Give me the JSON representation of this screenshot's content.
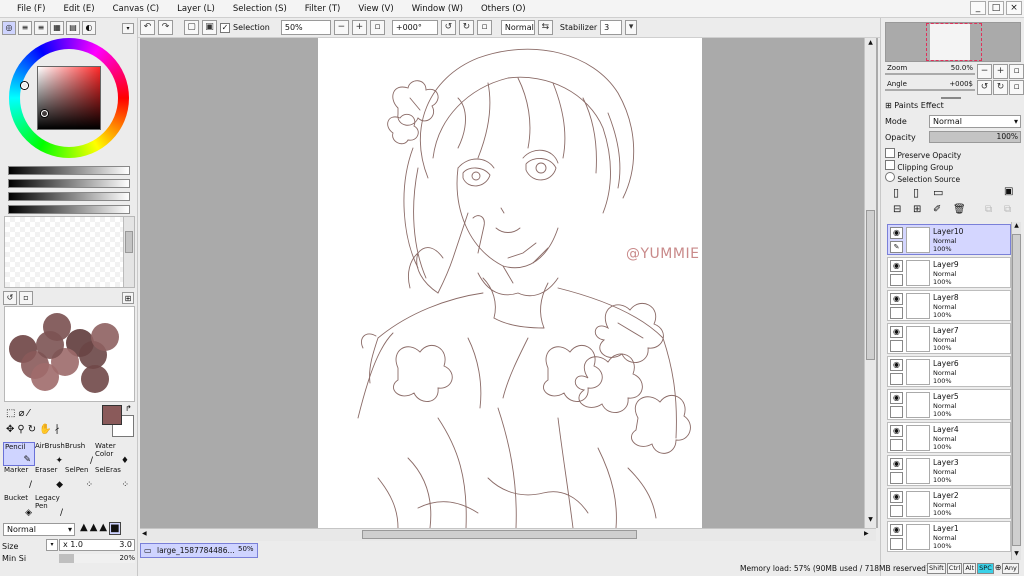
{
  "menu": [
    "File (F)",
    "Edit (E)",
    "Canvas (C)",
    "Layer (L)",
    "Selection (S)",
    "Filter (T)",
    "View (V)",
    "Window (W)",
    "Others (O)"
  ],
  "window_controls": [
    "_",
    "□",
    "×"
  ],
  "toolbar": {
    "selection_label": "Selection",
    "zoom_value": "50%",
    "angle_value": "+000°",
    "blend_value": "Normal",
    "stabilizer_label": "Stabilizer",
    "stabilizer_value": "3"
  },
  "left": {
    "tools": [
      {
        "label": "Pencil",
        "icon": "✎",
        "active": true
      },
      {
        "label": "AirBrush",
        "icon": "✦"
      },
      {
        "label": "Brush",
        "icon": "∕"
      },
      {
        "label": "Water Color",
        "icon": "♦"
      },
      {
        "label": "Marker",
        "icon": "∕"
      },
      {
        "label": "Eraser",
        "icon": "◆"
      },
      {
        "label": "SelPen",
        "icon": "⁘"
      },
      {
        "label": "SelEras",
        "icon": "⁘"
      },
      {
        "label": "Bucket",
        "icon": "◈"
      },
      {
        "label": "Legacy Pen",
        "icon": "∕"
      }
    ],
    "brush_mode": "Normal",
    "size_label": "Size",
    "size_multiplier": "x 1.0",
    "size_value": "3.0",
    "min_size_label": "Min Si",
    "min_size_value": "20%",
    "fg_color": "#8a5a5a",
    "palette_colors": [
      "#6e4444",
      "#7a5050",
      "#8a5a5a",
      "#5f3b3b",
      "#9c6a6a",
      "#6a4646",
      "#7c5353",
      "#8e6060",
      "#a06c6c",
      "#704848"
    ]
  },
  "canvas": {
    "watermark": "@YUMMIE",
    "watermark_color": "#c98a8a",
    "doc_tab_name": "large_1587784486...",
    "doc_tab_zoom": "50%"
  },
  "right": {
    "zoom_label": "Zoom",
    "zoom_value": "50.0%",
    "angle_label": "Angle",
    "angle_value": "+000$",
    "paints_effect": "Paints Effect",
    "mode_label": "Mode",
    "mode_value": "Normal",
    "opacity_label": "Opacity",
    "opacity_value": "100%",
    "preserve_opacity": "Preserve Opacity",
    "clipping_group": "Clipping Group",
    "selection_source": "Selection Source",
    "layers": [
      {
        "name": "Layer10",
        "mode": "Normal",
        "opacity": "100%",
        "active": true
      },
      {
        "name": "Layer9",
        "mode": "Normal",
        "opacity": "100%"
      },
      {
        "name": "Layer8",
        "mode": "Normal",
        "opacity": "100%"
      },
      {
        "name": "Layer7",
        "mode": "Normal",
        "opacity": "100%"
      },
      {
        "name": "Layer6",
        "mode": "Normal",
        "opacity": "100%"
      },
      {
        "name": "Layer5",
        "mode": "Normal",
        "opacity": "100%"
      },
      {
        "name": "Layer4",
        "mode": "Normal",
        "opacity": "100%"
      },
      {
        "name": "Layer3",
        "mode": "Normal",
        "opacity": "100%"
      },
      {
        "name": "Layer2",
        "mode": "Normal",
        "opacity": "100%"
      },
      {
        "name": "Layer1",
        "mode": "Normal",
        "opacity": "100%"
      }
    ]
  },
  "status": {
    "memory": "Memory load: 57% (90MB used / 718MB reserved)",
    "keys": [
      "Shift",
      "Ctrl",
      "Alt",
      "SPC",
      "Any"
    ]
  },
  "colors": {
    "accent": "#cfd4ff",
    "line_art": "#8a6a66",
    "canvas_bg": "#aaaaaa"
  }
}
